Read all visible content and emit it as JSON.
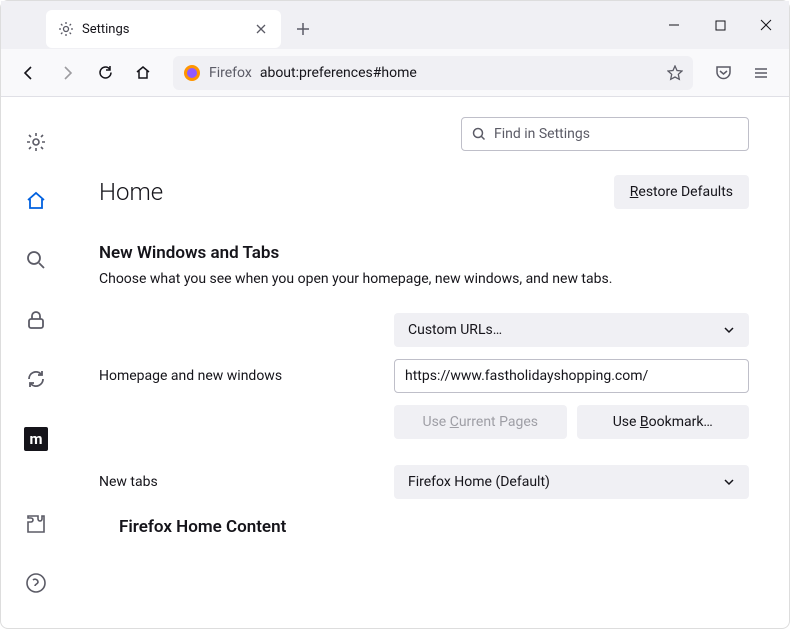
{
  "tab": {
    "title": "Settings"
  },
  "urlbar": {
    "prefix": "Firefox",
    "url": "about:preferences#home"
  },
  "search": {
    "placeholder": "Find in Settings"
  },
  "page": {
    "title": "Home",
    "restore_label": "Restore Defaults"
  },
  "section1": {
    "title": "New Windows and Tabs",
    "desc": "Choose what you see when you open your homepage, new windows, and new tabs."
  },
  "homepage": {
    "dropdown_label": "Custom URLs…",
    "row_label": "Homepage and new windows",
    "url_value": "https://www.fastholidayshopping.com/",
    "use_current": "Use Current Pages",
    "use_bookmark": "Use Bookmark…"
  },
  "newtabs": {
    "label": "New tabs",
    "dropdown_label": "Firefox Home (Default)"
  },
  "section2": {
    "title": "Firefox Home Content"
  }
}
